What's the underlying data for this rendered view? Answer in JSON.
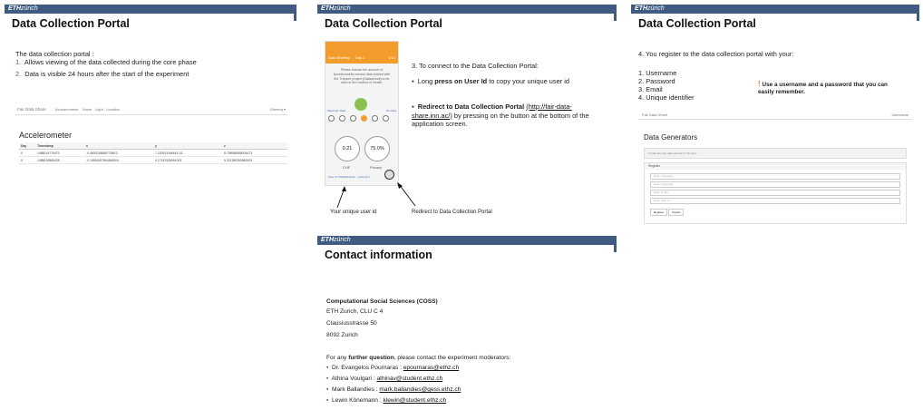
{
  "slide1": {
    "logo": "ETH",
    "logo_suffix": "zürich",
    "title": "Data Collection Portal",
    "intro": "The data collection portal :",
    "items": [
      {
        "num": "1.",
        "text": "Allows viewing of the data collected during the core phase"
      },
      {
        "num": "2.",
        "text": "Data is visible 24 hours after the start of the experiment"
      }
    ],
    "nav": {
      "brand": "Fair Data Share",
      "links": [
        "Accelerometer",
        "Noise",
        "Light",
        "Location"
      ],
      "user": "Dheeraj ▾"
    },
    "section_title": "Accelerometer",
    "table": {
      "headers": [
        "Day",
        "Timestamp",
        "x",
        "y",
        "z"
      ],
      "rows": [
        [
          "0",
          "1488019775479",
          "-0.46002188857754E2",
          "7.22091316661E-01",
          "8.798958088004473"
        ],
        [
          "0",
          "1488019865428",
          "-0.15551697964849004",
          "0.17187926991003",
          "9.321380393880003"
        ]
      ]
    }
  },
  "slide2": {
    "logo": "ETH",
    "logo_suffix": "zürich",
    "title": "Data Collection Portal",
    "step": "3. To connect to the Data Collection Portal:",
    "bullet1_pre": "Long ",
    "bullet1_bold": "press on User Id",
    "bullet1_post": " to copy your unique user id",
    "bullet2_bold": "Redirect to Data Collection Portal",
    "bullet2_link": "(http://fair-data-share.inn.ac/)",
    "bullet2_post": " by pressing on the button at the bottom of the application screen.",
    "caption_left": "Your unique user id",
    "caption_right": "Redirect to Data Collection Portal",
    "phone": {
      "tab_left": "Data Sharing",
      "tab_mid": "Day 2",
      "tab_right": "1/14",
      "prompt": "Please choose the amount of Accelerometer sensor data shared with the Trapzee project (Dataschool) to be used in the context of Health.",
      "min": "Maximum Data",
      "max": "No Data",
      "chf": "0.21",
      "chf_label": "CHF",
      "privacy": "75.0%",
      "privacy_label": "Privacy",
      "footer": "User Id: 57d0a1b2c3e... | Round 1"
    }
  },
  "slide3": {
    "logo": "ETH",
    "logo_suffix": "zürich",
    "title": "Data Collection Portal",
    "step": "4. You register to the data collection portal with your:",
    "fields": [
      "1. Username",
      "2. Password",
      "3. Email",
      "4. Unique identifier"
    ],
    "warn_mark": "!",
    "warn": "Use a username and a password that you can easily remember.",
    "nav_brand": "Fair Data Share",
    "nav_right": "Username",
    "section_title": "Data Generators",
    "notice": "Create the new data provider in the App.",
    "form_title": "Register",
    "placeholders": [
      "Enter Username",
      "Enter Password",
      "Enter Email",
      "Enter User Id"
    ],
    "buttons": [
      "Register",
      "Cancel"
    ]
  },
  "slide4": {
    "logo": "ETH",
    "logo_suffix": "zürich",
    "title": "Contact information",
    "org": "Computational Social Sciences (COSS)",
    "addr": [
      "ETH Zurich, CLU C 4",
      "Clausiusstrasse 50",
      "8092 Zurich"
    ],
    "q_pre": "For any ",
    "q_bold": "further question",
    "q_post": ", please contact the experiment moderators:",
    "contacts": [
      {
        "name": "Dr. Evangelos Pournaras : ",
        "email": "epournaras@ethz.ch"
      },
      {
        "name": "Athina Voulgari : ",
        "email": "athinav@student.ethz.ch"
      },
      {
        "name": "Mark Ballandies : ",
        "email": "mark.ballandies@gess.ethz.ch"
      },
      {
        "name": "Lewin Könemann : ",
        "email": "klewin@student.ethz.ch"
      }
    ]
  }
}
